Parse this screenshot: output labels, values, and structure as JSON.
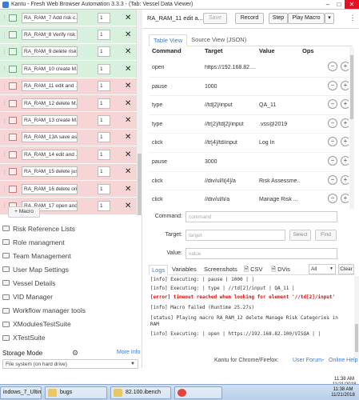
{
  "window": {
    "title": "Kantu - Fresh Web Browser Automation 3.3.3 - (Tab: Vessel Data Viewer)"
  },
  "macros": [
    {
      "name": "RA_RAM_7 Add risk c...",
      "count": "1",
      "status": "success"
    },
    {
      "name": "RA_RAM_8 Verify risk ...",
      "count": "1",
      "status": "success"
    },
    {
      "name": "RA_RAM_9 delete risk ...",
      "count": "1",
      "status": "success"
    },
    {
      "name": "RA_RAM_10 create M...",
      "count": "1",
      "status": "success"
    },
    {
      "name": "RA_RAM_11 edit and ...",
      "count": "1",
      "status": "error"
    },
    {
      "name": "RA_RAM_12 delete M...",
      "count": "1",
      "status": "error"
    },
    {
      "name": "RA_RAM_13 create M...",
      "count": "1",
      "status": "error"
    },
    {
      "name": "RA_RAM_13A save as ...",
      "count": "1",
      "status": "error"
    },
    {
      "name": "RA_RAM_14 edit and ...",
      "count": "1",
      "status": "error"
    },
    {
      "name": "RA_RAM_15 delete jus...",
      "count": "1",
      "status": "error"
    },
    {
      "name": "RA_RAM_16 delete ori...",
      "count": "1",
      "status": "error"
    },
    {
      "name": "RA_RAM_17 open and ...",
      "count": "1",
      "status": "error"
    }
  ],
  "add_macro_label": "+ Macro",
  "folders": [
    "Risk Reference Lists",
    "Role managment",
    "Team Management",
    "User Map Settings",
    "Vessel Details",
    "VID Manager",
    "Workflow manager tools",
    "XModulesTestSuite",
    "XTestSuite"
  ],
  "storage": {
    "heading": "Storage Mode",
    "more_info": "More Info",
    "selected": "File system (on hard drive)"
  },
  "toolbar": {
    "macro_title": "RA_RAM_11 edit a...",
    "save": "Save",
    "record": "Record",
    "step": "Step",
    "play": "Play Macro",
    "more": "⋮"
  },
  "tabs": {
    "table": "Table View",
    "source": "Source View (JSON)"
  },
  "table": {
    "headers": {
      "command": "Command",
      "target": "Target",
      "value": "Value",
      "ops": "Ops"
    },
    "rows": [
      {
        "command": "open",
        "target": "https://192.168.82....",
        "value": ""
      },
      {
        "command": "pause",
        "target": "1000",
        "value": ""
      },
      {
        "command": "type",
        "target": "//td[2]/input",
        "value": "QA_11"
      },
      {
        "command": "type",
        "target": "//tr[2]/td[2]/input",
        "value": ".vss@2019"
      },
      {
        "command": "click",
        "target": "//tr[4]/td/input",
        "value": "Log In"
      },
      {
        "command": "pause",
        "target": "3000",
        "value": ""
      },
      {
        "command": "click",
        "target": "//div/ul/li[4]/a",
        "value": "Risk Assessme..."
      },
      {
        "command": "click",
        "target": "//div/ul/li/a",
        "value": "Manage Risk ..."
      }
    ],
    "op_minus": "−",
    "op_plus": "+"
  },
  "editor": {
    "command_label": "Command:",
    "command_placeholder": "command",
    "target_label": "Target:",
    "target_placeholder": "target",
    "select": "Select",
    "find": "Find",
    "value_label": "Value:",
    "value_placeholder": "value"
  },
  "log": {
    "tabs": [
      "Logs",
      "Variables",
      "Screenshots",
      "CSV",
      "DVis"
    ],
    "filter": "All",
    "clear": "Clear",
    "lines": [
      {
        "text": "[info] Executing:  | pause | 1000 |  |",
        "type": "info"
      },
      {
        "text": "[info] Executing:  | type | //td[2]/input | QA_11 |",
        "type": "info"
      },
      {
        "text": "[error] timeout reached when looking for element '//td[2]/input'",
        "type": "error"
      },
      {
        "text": "[info] Macro failed (Runtime 25.27s)",
        "type": "info"
      },
      {
        "text": "[status] Playing macro RA_RAM_12  delete Manage Risk Categories in RAM",
        "type": "info"
      },
      {
        "text": "[info] Executing:  | open | https://192.168.82.100/VISQA |  |",
        "type": "info"
      }
    ]
  },
  "footer": {
    "prefix": "Kantu for Chrome/Firefox:",
    "link1": "User Forum",
    "sep": " - ",
    "link2": "Online Help"
  },
  "taskbar": {
    "items": [
      "indows_7_Ultim...",
      "bugs",
      "82.100.ibench",
      ""
    ],
    "time": "11:38 AM",
    "date": "11/21/2018"
  }
}
